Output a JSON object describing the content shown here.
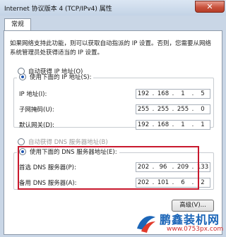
{
  "window": {
    "title": "Internet 协议版本 4 (TCP/IPv4) 属性",
    "close_symbol": "✕"
  },
  "tabs": [
    {
      "label": "常规",
      "selected": true
    }
  ],
  "description": "如果网络支持此功能，则可以获取自动指派的 IP 设置。否则，您需要从网络系统管理员处获得适当的 IP 设置。",
  "ip_section": {
    "auto_label": "自动获得 IP 地址(O)",
    "manual_label": "使用下面的 IP 地址(S):",
    "selected": "manual",
    "fields": [
      {
        "label": "IP 地址(I):",
        "octets": [
          "192",
          "168",
          "1",
          "5"
        ]
      },
      {
        "label": "子网掩码(U):",
        "octets": [
          "255",
          "255",
          "255",
          "0"
        ]
      },
      {
        "label": "默认网关(D):",
        "octets": [
          "192",
          "168",
          "1",
          "1"
        ]
      }
    ]
  },
  "dns_section": {
    "auto_label": "自动获得 DNS 服务器地址(B)",
    "manual_label": "使用下面的 DNS 服务器地址(E):",
    "selected": "manual",
    "fields": [
      {
        "label": "首选 DNS 服务器(P):",
        "octets": [
          "202",
          "96",
          "209",
          "133"
        ]
      },
      {
        "label": "备用 DNS 服务器(A):",
        "octets": [
          "202",
          "101",
          "6",
          "2"
        ]
      }
    ],
    "highlight_color": "#c8182d"
  },
  "buttons": {
    "advanced": "高级(V)..."
  },
  "watermark": {
    "title": "鹏鑫装机网",
    "url": "www.0753px.com"
  }
}
